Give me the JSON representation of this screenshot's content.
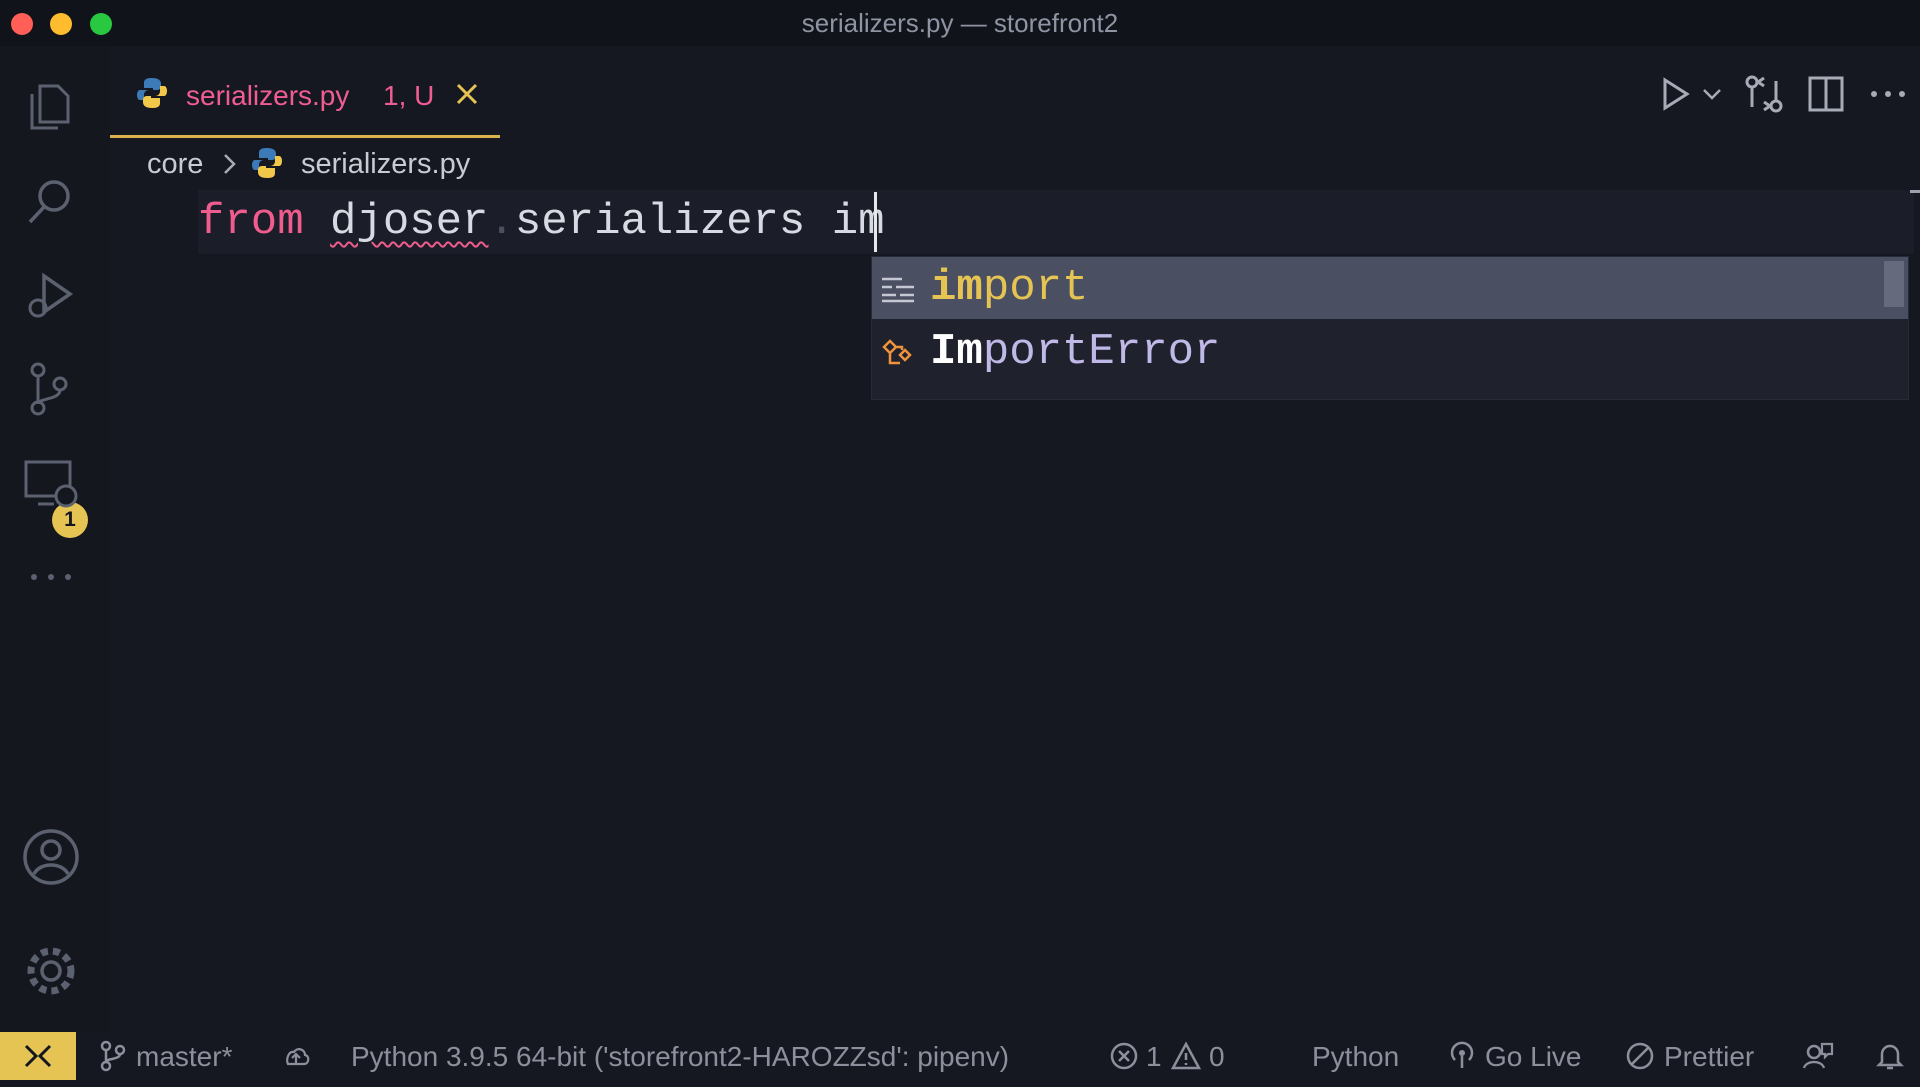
{
  "window": {
    "title": "serializers.py — storefront2"
  },
  "activity_bar": {
    "items": [
      {
        "icon": "explorer-icon"
      },
      {
        "icon": "search-icon"
      },
      {
        "icon": "run-debug-icon"
      },
      {
        "icon": "source-control-icon",
        "badge": "1"
      },
      {
        "icon": "remote-explorer-icon"
      },
      {
        "icon": "more-icon"
      },
      {
        "icon": "account-icon"
      },
      {
        "icon": "settings-gear-icon"
      }
    ]
  },
  "tab": {
    "filename": "serializers.py",
    "status": "1, U"
  },
  "breadcrumb": {
    "folder": "core",
    "file": "serializers.py"
  },
  "editor": {
    "line": {
      "keyword": "from",
      "module_a": "djoser",
      "dot": ".",
      "module_b": "serializers",
      "typed": "im"
    }
  },
  "suggestions": [
    {
      "icon": "keyword-icon",
      "match": "im",
      "rest": "port",
      "selected": true
    },
    {
      "icon": "class-icon",
      "match": "Im",
      "rest": "portError",
      "selected": false
    }
  ],
  "statusbar": {
    "branch": "master*",
    "interpreter": "Python 3.9.5 64-bit ('storefront2-HAROZZsd': pipenv)",
    "errors": "1",
    "warnings": "0",
    "language": "Python",
    "go_live": "Go Live",
    "prettier": "Prettier"
  },
  "colors": {
    "accent": "#e5c453",
    "keyword": "#f05c8e",
    "background": "#161821"
  }
}
